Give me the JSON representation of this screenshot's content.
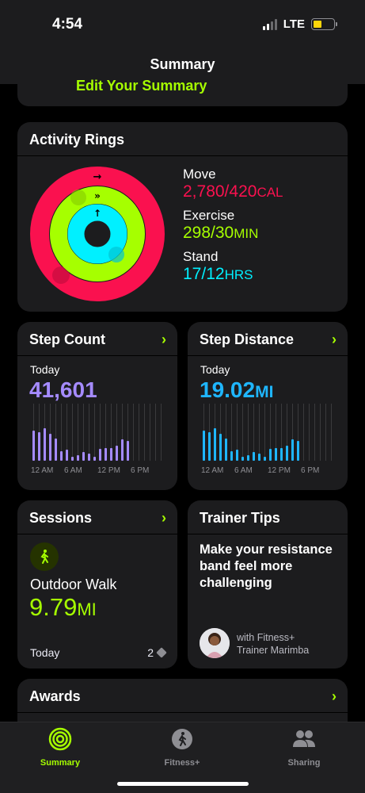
{
  "status": {
    "time": "4:54",
    "network": "LTE"
  },
  "nav": {
    "title": "Summary"
  },
  "edit": {
    "label": "Edit Your Summary"
  },
  "rings": {
    "title": "Activity Rings",
    "move": {
      "label": "Move",
      "value": "2,780/420",
      "unit": "CAL"
    },
    "exercise": {
      "label": "Exercise",
      "value": "298/30",
      "unit": "MIN"
    },
    "stand": {
      "label": "Stand",
      "value": "17/12",
      "unit": "HRS"
    }
  },
  "step_count": {
    "title": "Step Count",
    "period": "Today",
    "value": "41,601",
    "unit": "",
    "axis": [
      "12 AM",
      "6 AM",
      "12 PM",
      "6 PM"
    ],
    "hourly": [
      0.62,
      0.58,
      0.66,
      0.55,
      0.45,
      0.2,
      0.22,
      0.08,
      0.12,
      0.18,
      0.14,
      0.08,
      0.24,
      0.25,
      0.26,
      0.3,
      0.44,
      0.4,
      0,
      0,
      0,
      0,
      0,
      0
    ]
  },
  "step_distance": {
    "title": "Step Distance",
    "period": "Today",
    "value": "19.02",
    "unit": "MI",
    "axis": [
      "12 AM",
      "6 AM",
      "12 PM",
      "6 PM"
    ],
    "hourly": [
      0.62,
      0.58,
      0.66,
      0.55,
      0.45,
      0.2,
      0.22,
      0.08,
      0.12,
      0.18,
      0.14,
      0.08,
      0.24,
      0.25,
      0.26,
      0.3,
      0.44,
      0.4,
      0,
      0,
      0,
      0,
      0,
      0
    ]
  },
  "sessions": {
    "title": "Sessions",
    "activity": "Outdoor Walk",
    "value": "9.79",
    "unit": "MI",
    "period": "Today",
    "count": "2"
  },
  "tips": {
    "title": "Trainer Tips",
    "headline": "Make your resistance band feel more challenging",
    "credit_line1": "with Fitness+",
    "credit_line2": "Trainer Marimba"
  },
  "awards": {
    "title": "Awards"
  },
  "tabs": [
    {
      "label": "Summary",
      "active": true
    },
    {
      "label": "Fitness+",
      "active": false
    },
    {
      "label": "Sharing",
      "active": false
    }
  ],
  "colors": {
    "move": "#fa114f",
    "exercise": "#a6ff00",
    "stand": "#00f0ff",
    "steps": "#a58bff",
    "distance": "#1fb6ff"
  }
}
